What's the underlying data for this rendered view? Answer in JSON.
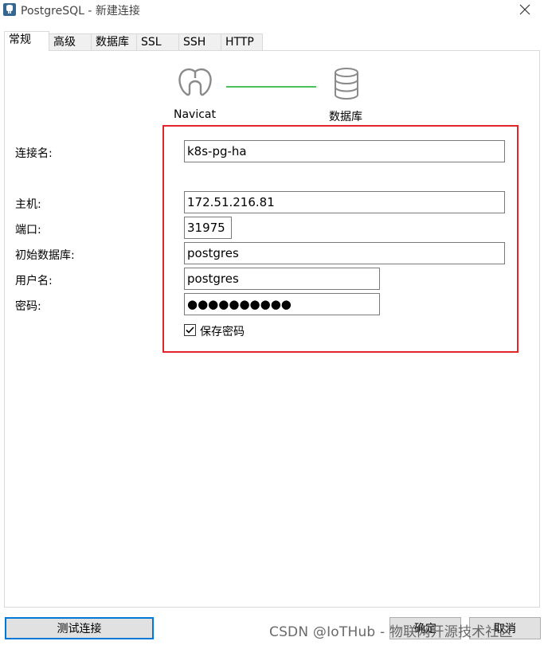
{
  "window": {
    "title": "PostgreSQL - 新建连接",
    "icons": {
      "app": "elephant-icon",
      "close": "close-icon"
    }
  },
  "tabs": [
    {
      "label": "常规",
      "active": true
    },
    {
      "label": "高级",
      "active": false
    },
    {
      "label": "数据库",
      "active": false
    },
    {
      "label": "SSL",
      "active": false
    },
    {
      "label": "SSH",
      "active": false
    },
    {
      "label": "HTTP",
      "active": false
    }
  ],
  "header": {
    "left_label": "Navicat",
    "right_label": "数据库",
    "line_color": "#4cc05a"
  },
  "form": {
    "connection_name": {
      "label": "连接名:",
      "value": "k8s-pg-ha"
    },
    "host": {
      "label": "主机:",
      "value": "172.51.216.81"
    },
    "port": {
      "label": "端口:",
      "value": "31975"
    },
    "initial_db": {
      "label": "初始数据库:",
      "value": "postgres"
    },
    "username": {
      "label": "用户名:",
      "value": "postgres"
    },
    "password": {
      "label": "密码:",
      "value": "●●●●●●●●●●"
    },
    "save_password": {
      "label": "保存密码",
      "checked": true
    }
  },
  "highlight_color": "#e2242b",
  "buttons": {
    "test": "测试连接",
    "ok": "确定",
    "cancel": "取消"
  },
  "watermark": "CSDN @IoTHub - 物联网开源技术社区"
}
